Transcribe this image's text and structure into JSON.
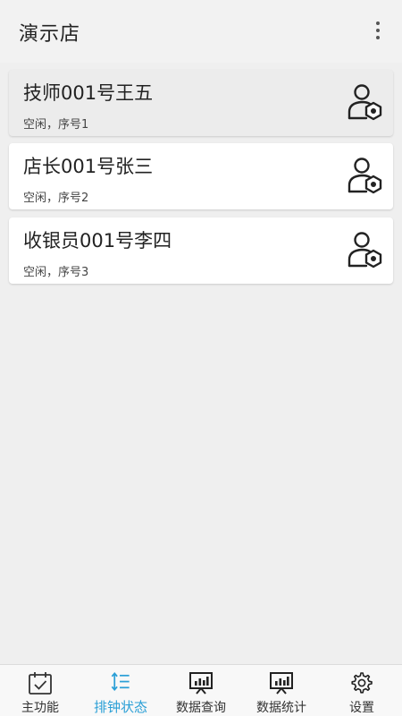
{
  "header": {
    "title": "演示店",
    "menu_icon": "more-vert-icon"
  },
  "staff": [
    {
      "name": "技师001号王五",
      "status": "空闲，序号1",
      "icon": "user-settings-icon",
      "selected": true
    },
    {
      "name": "店长001号张三",
      "status": "空闲，序号2",
      "icon": "user-settings-icon",
      "selected": false
    },
    {
      "name": "收银员001号李四",
      "status": "空闲，序号3",
      "icon": "user-settings-icon",
      "selected": false
    }
  ],
  "bottom_nav": {
    "active_color": "#2a9fd6",
    "items": [
      {
        "label": "主功能",
        "icon": "calendar-check-icon"
      },
      {
        "label": "排钟状态",
        "icon": "sort-list-icon",
        "active": true
      },
      {
        "label": "数据查询",
        "icon": "presentation-chart-icon"
      },
      {
        "label": "数据统计",
        "icon": "presentation-chart-icon"
      },
      {
        "label": "设置",
        "icon": "gear-icon"
      }
    ]
  }
}
